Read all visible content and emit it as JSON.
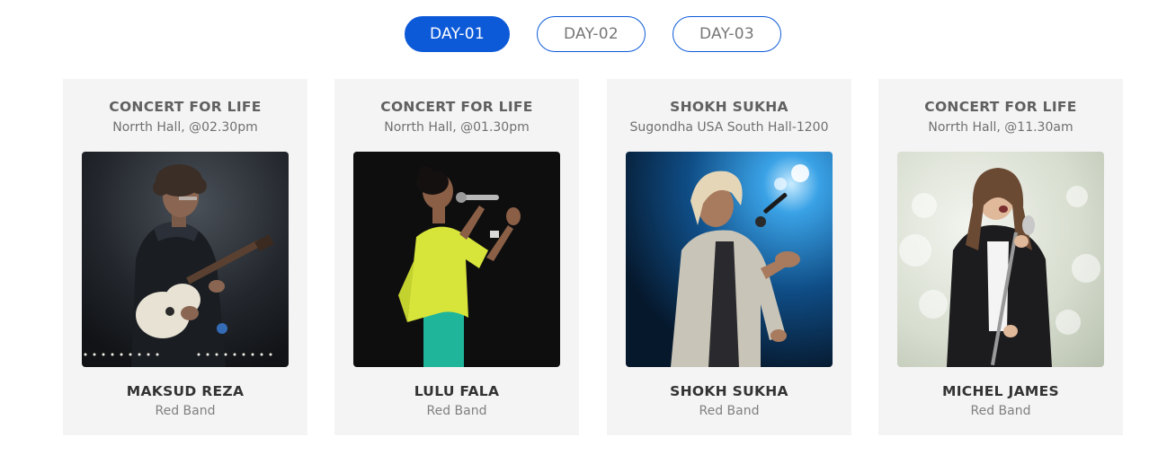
{
  "tabs": [
    {
      "label": "DAY-01",
      "active": true
    },
    {
      "label": "DAY-02",
      "active": false
    },
    {
      "label": "DAY-03",
      "active": false
    }
  ],
  "cards": [
    {
      "title": "CONCERT FOR LIFE",
      "location": "Norrth Hall, @02.30pm",
      "artist": "MAKSUD REZA",
      "band": "Red Band",
      "photo": "guitarist-photo"
    },
    {
      "title": "CONCERT FOR LIFE",
      "location": "Norrth Hall, @01.30pm",
      "artist": "LULU FALA",
      "band": "Red Band",
      "photo": "singer-photo"
    },
    {
      "title": "SHOKH SUKHA",
      "location": "Sugondha USA South Hall-1200",
      "artist": "SHOKH SUKHA",
      "band": "Red Band",
      "photo": "performer-photo"
    },
    {
      "title": "CONCERT FOR LIFE",
      "location": "Norrth Hall, @11.30am",
      "artist": "MICHEL JAMES",
      "band": "Red Band",
      "photo": "vocalist-photo"
    }
  ],
  "colors": {
    "accent": "#0d5ad8",
    "card_background": "#f4f4f4",
    "heading_text": "#606060",
    "artist_text": "#333333"
  }
}
